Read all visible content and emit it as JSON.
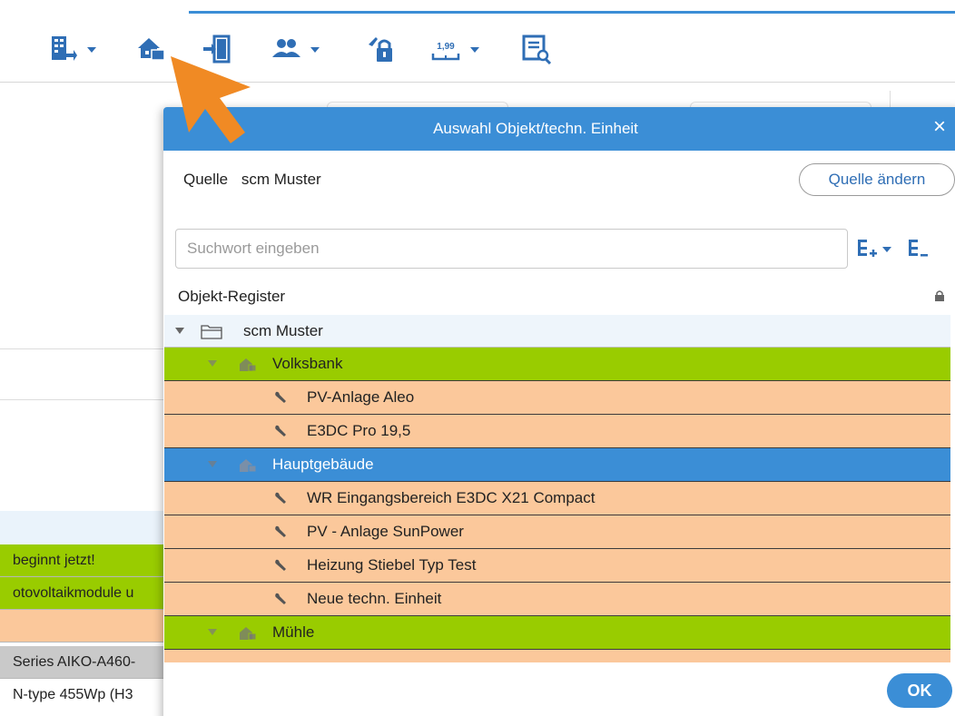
{
  "toolbar": {
    "items": [
      {
        "icon": "report-export-icon",
        "has_dropdown": true
      },
      {
        "icon": "object-select-icon",
        "has_dropdown": false
      },
      {
        "icon": "door-login-icon",
        "has_dropdown": false
      },
      {
        "icon": "users-icon",
        "has_dropdown": true
      },
      {
        "icon": "lock-settings-icon",
        "has_dropdown": false
      },
      {
        "icon": "price-icon",
        "label": "1,99",
        "has_dropdown": true
      },
      {
        "icon": "document-search-icon",
        "has_dropdown": false
      }
    ]
  },
  "background": {
    "rows": [
      {
        "text": "beginnt jetzt!",
        "style": "green"
      },
      {
        "text": "otovoltaikmodule u",
        "style": "green"
      },
      {
        "text": "",
        "style": "peach"
      },
      {
        "text": "Series AIKO-A460-",
        "style": "grey"
      },
      {
        "text": "N-type 455Wp (H3",
        "style": "white"
      }
    ]
  },
  "dialog": {
    "title": "Auswahl Objekt/techn. Einheit",
    "close_glyph": "×",
    "source_label": "Quelle",
    "source_value": "scm Muster",
    "change_source_label": "Quelle ändern",
    "search_placeholder": "Suchwort eingeben",
    "register_label": "Objekt-Register",
    "ok_label": "OK",
    "tree": [
      {
        "label": "scm Muster",
        "type": "folder",
        "level": 0,
        "style": "root"
      },
      {
        "label": "Volksbank",
        "type": "building",
        "level": 1,
        "style": "green"
      },
      {
        "label": "PV-Anlage Aleo",
        "type": "unit",
        "level": 2,
        "style": "peach"
      },
      {
        "label": "E3DC Pro 19,5",
        "type": "unit",
        "level": 2,
        "style": "peach"
      },
      {
        "label": "Hauptgebäude",
        "type": "building",
        "level": 1,
        "style": "selected"
      },
      {
        "label": "WR Eingangsbereich E3DC X21 Compact",
        "type": "unit",
        "level": 2,
        "style": "peach"
      },
      {
        "label": "PV - Anlage SunPower",
        "type": "unit",
        "level": 2,
        "style": "peach"
      },
      {
        "label": "Heizung Stiebel Typ Test",
        "type": "unit",
        "level": 2,
        "style": "peach"
      },
      {
        "label": "Neue techn. Einheit",
        "type": "unit",
        "level": 2,
        "style": "peach"
      },
      {
        "label": "Mühle",
        "type": "building",
        "level": 1,
        "style": "green"
      },
      {
        "label": "",
        "type": "unit",
        "level": 2,
        "style": "peach"
      }
    ]
  },
  "colors": {
    "accent": "#3b8ed6",
    "green_row": "#99cc00",
    "peach_row": "#fbc89b",
    "annotation_arrow": "#f08a24"
  }
}
